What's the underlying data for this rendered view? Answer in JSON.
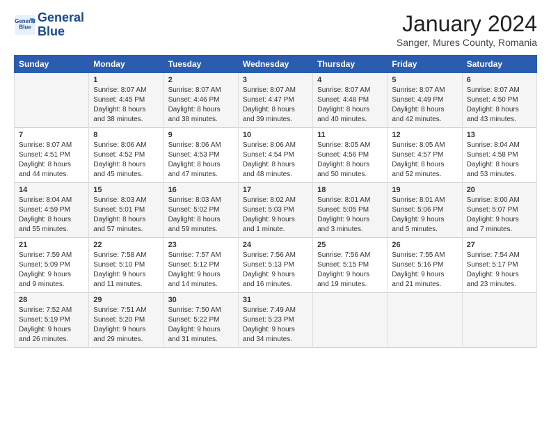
{
  "header": {
    "logo_line1": "General",
    "logo_line2": "Blue",
    "month_title": "January 2024",
    "subtitle": "Sanger, Mures County, Romania"
  },
  "days_of_week": [
    "Sunday",
    "Monday",
    "Tuesday",
    "Wednesday",
    "Thursday",
    "Friday",
    "Saturday"
  ],
  "weeks": [
    [
      {
        "day": "",
        "info": ""
      },
      {
        "day": "1",
        "info": "Sunrise: 8:07 AM\nSunset: 4:45 PM\nDaylight: 8 hours\nand 38 minutes."
      },
      {
        "day": "2",
        "info": "Sunrise: 8:07 AM\nSunset: 4:46 PM\nDaylight: 8 hours\nand 38 minutes."
      },
      {
        "day": "3",
        "info": "Sunrise: 8:07 AM\nSunset: 4:47 PM\nDaylight: 8 hours\nand 39 minutes."
      },
      {
        "day": "4",
        "info": "Sunrise: 8:07 AM\nSunset: 4:48 PM\nDaylight: 8 hours\nand 40 minutes."
      },
      {
        "day": "5",
        "info": "Sunrise: 8:07 AM\nSunset: 4:49 PM\nDaylight: 8 hours\nand 42 minutes."
      },
      {
        "day": "6",
        "info": "Sunrise: 8:07 AM\nSunset: 4:50 PM\nDaylight: 8 hours\nand 43 minutes."
      }
    ],
    [
      {
        "day": "7",
        "info": "Sunrise: 8:07 AM\nSunset: 4:51 PM\nDaylight: 8 hours\nand 44 minutes."
      },
      {
        "day": "8",
        "info": "Sunrise: 8:06 AM\nSunset: 4:52 PM\nDaylight: 8 hours\nand 45 minutes."
      },
      {
        "day": "9",
        "info": "Sunrise: 8:06 AM\nSunset: 4:53 PM\nDaylight: 8 hours\nand 47 minutes."
      },
      {
        "day": "10",
        "info": "Sunrise: 8:06 AM\nSunset: 4:54 PM\nDaylight: 8 hours\nand 48 minutes."
      },
      {
        "day": "11",
        "info": "Sunrise: 8:05 AM\nSunset: 4:56 PM\nDaylight: 8 hours\nand 50 minutes."
      },
      {
        "day": "12",
        "info": "Sunrise: 8:05 AM\nSunset: 4:57 PM\nDaylight: 8 hours\nand 52 minutes."
      },
      {
        "day": "13",
        "info": "Sunrise: 8:04 AM\nSunset: 4:58 PM\nDaylight: 8 hours\nand 53 minutes."
      }
    ],
    [
      {
        "day": "14",
        "info": "Sunrise: 8:04 AM\nSunset: 4:59 PM\nDaylight: 8 hours\nand 55 minutes."
      },
      {
        "day": "15",
        "info": "Sunrise: 8:03 AM\nSunset: 5:01 PM\nDaylight: 8 hours\nand 57 minutes."
      },
      {
        "day": "16",
        "info": "Sunrise: 8:03 AM\nSunset: 5:02 PM\nDaylight: 8 hours\nand 59 minutes."
      },
      {
        "day": "17",
        "info": "Sunrise: 8:02 AM\nSunset: 5:03 PM\nDaylight: 9 hours\nand 1 minute."
      },
      {
        "day": "18",
        "info": "Sunrise: 8:01 AM\nSunset: 5:05 PM\nDaylight: 9 hours\nand 3 minutes."
      },
      {
        "day": "19",
        "info": "Sunrise: 8:01 AM\nSunset: 5:06 PM\nDaylight: 9 hours\nand 5 minutes."
      },
      {
        "day": "20",
        "info": "Sunrise: 8:00 AM\nSunset: 5:07 PM\nDaylight: 9 hours\nand 7 minutes."
      }
    ],
    [
      {
        "day": "21",
        "info": "Sunrise: 7:59 AM\nSunset: 5:09 PM\nDaylight: 9 hours\nand 9 minutes."
      },
      {
        "day": "22",
        "info": "Sunrise: 7:58 AM\nSunset: 5:10 PM\nDaylight: 9 hours\nand 11 minutes."
      },
      {
        "day": "23",
        "info": "Sunrise: 7:57 AM\nSunset: 5:12 PM\nDaylight: 9 hours\nand 14 minutes."
      },
      {
        "day": "24",
        "info": "Sunrise: 7:56 AM\nSunset: 5:13 PM\nDaylight: 9 hours\nand 16 minutes."
      },
      {
        "day": "25",
        "info": "Sunrise: 7:56 AM\nSunset: 5:15 PM\nDaylight: 9 hours\nand 19 minutes."
      },
      {
        "day": "26",
        "info": "Sunrise: 7:55 AM\nSunset: 5:16 PM\nDaylight: 9 hours\nand 21 minutes."
      },
      {
        "day": "27",
        "info": "Sunrise: 7:54 AM\nSunset: 5:17 PM\nDaylight: 9 hours\nand 23 minutes."
      }
    ],
    [
      {
        "day": "28",
        "info": "Sunrise: 7:52 AM\nSunset: 5:19 PM\nDaylight: 9 hours\nand 26 minutes."
      },
      {
        "day": "29",
        "info": "Sunrise: 7:51 AM\nSunset: 5:20 PM\nDaylight: 9 hours\nand 29 minutes."
      },
      {
        "day": "30",
        "info": "Sunrise: 7:50 AM\nSunset: 5:22 PM\nDaylight: 9 hours\nand 31 minutes."
      },
      {
        "day": "31",
        "info": "Sunrise: 7:49 AM\nSunset: 5:23 PM\nDaylight: 9 hours\nand 34 minutes."
      },
      {
        "day": "",
        "info": ""
      },
      {
        "day": "",
        "info": ""
      },
      {
        "day": "",
        "info": ""
      }
    ]
  ]
}
